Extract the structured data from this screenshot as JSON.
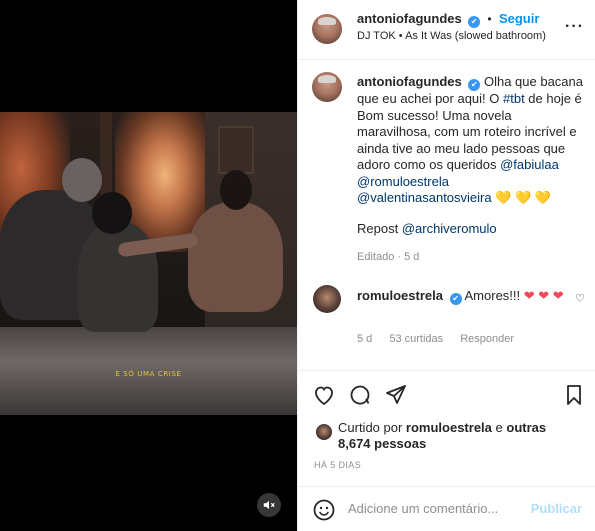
{
  "media": {
    "subtitle": "E SÓ UMA CRISE",
    "mute_icon": "speaker-muted-icon"
  },
  "header": {
    "username": "antoniofagundes",
    "verified_icon": "✔",
    "dot": "•",
    "follow_label": "Seguir",
    "audio": "DJ TOK • As It Was (slowed bathroom)",
    "more_icon": "···"
  },
  "caption": {
    "username": "antoniofagundes",
    "text_before": "Olha que bacana que eu achei por aqui! O ",
    "hashtag": "#tbt",
    "text_middle": " de hoje é Bom sucesso! Uma novela maravilhosa, com um roteiro incrível e ainda tive ao meu lado pessoas que adoro como os queridos ",
    "mention1": "@fabiulaa",
    "space1": " ",
    "mention2": "@romuloestrela",
    "space2": " ",
    "mention3": "@valentinasantosvieira",
    "hearts": " 💛 💛 💛",
    "repost_prefix": "Repost ",
    "repost_mention": "@archiveromulo",
    "edited": "Editado · 5 d"
  },
  "comment": {
    "username": "romuloestrela",
    "text": "Amores!!! ",
    "hearts": "❤ ❤ ❤",
    "time": "5 d",
    "likes": "53 curtidas",
    "reply": "Responder",
    "like_icon": "♡"
  },
  "likes": {
    "prefix": "Curtido por ",
    "user": "romuloestrela",
    "middle": " e ",
    "others": "outras 8,674 pessoas"
  },
  "time_ago": "HÁ 5 DIAS",
  "comment_box": {
    "placeholder": "Adicione um comentário...",
    "publish": "Publicar"
  }
}
